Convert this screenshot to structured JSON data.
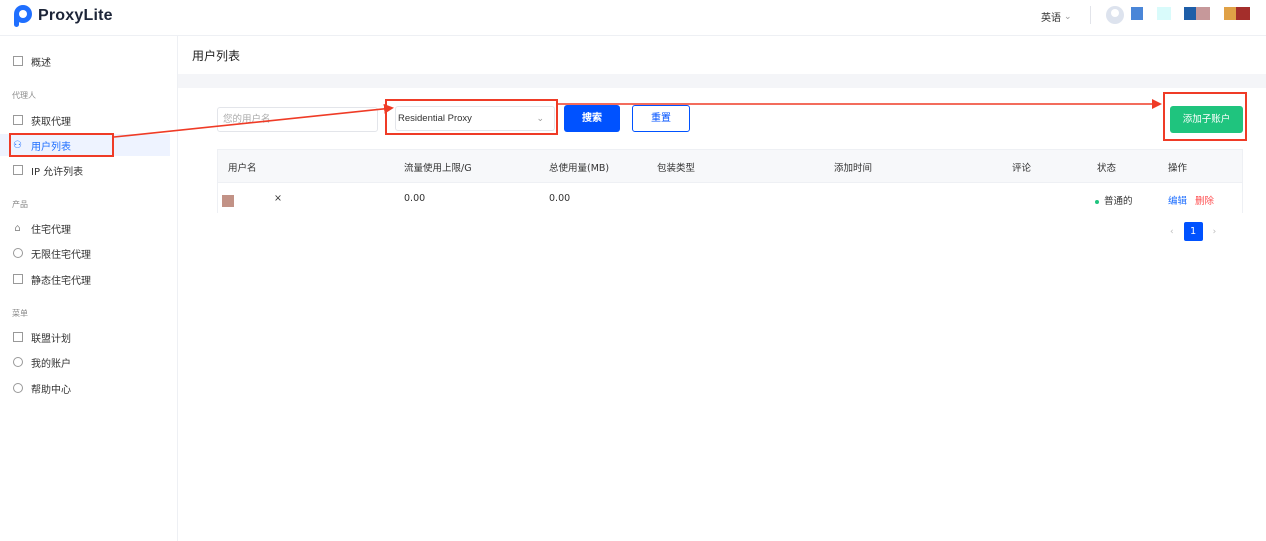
{
  "app": {
    "name": "ProxyLite"
  },
  "header": {
    "language": "英语"
  },
  "sidebar": {
    "items": [
      {
        "label": "概述"
      },
      {
        "label": "获取代理"
      },
      {
        "label": "用户列表"
      },
      {
        "label": "IP 允许列表"
      },
      {
        "label": "住宅代理"
      },
      {
        "label": "无限住宅代理"
      },
      {
        "label": "静态住宅代理"
      },
      {
        "label": "联盟计划"
      },
      {
        "label": "我的账户"
      },
      {
        "label": "帮助中心"
      }
    ],
    "sections": [
      "代理人",
      "产品",
      "菜单"
    ]
  },
  "page": {
    "title": "用户列表"
  },
  "filters": {
    "username_placeholder": "您的用户名",
    "proxy_type": "Residential Proxy",
    "search_label": "搜索",
    "reset_label": "重置",
    "add_label": "添加子账户"
  },
  "table": {
    "headers": [
      "用户名",
      "流量使用上限/G",
      "总使用量(MB)",
      "包装类型",
      "添加时间",
      "评论",
      "状态",
      "操作"
    ],
    "rows": [
      {
        "mark": "×",
        "limit": "0.00",
        "used": "0.00",
        "status": "普通的",
        "edit": "编辑",
        "delete": "删除"
      }
    ]
  },
  "pagination": {
    "current": "1",
    "prev": "‹",
    "next": "›"
  },
  "colors": {
    "primary": "#0052ff",
    "success": "#1fc47e",
    "danger": "#ff4d4f",
    "annotation": "#ef3b26"
  }
}
